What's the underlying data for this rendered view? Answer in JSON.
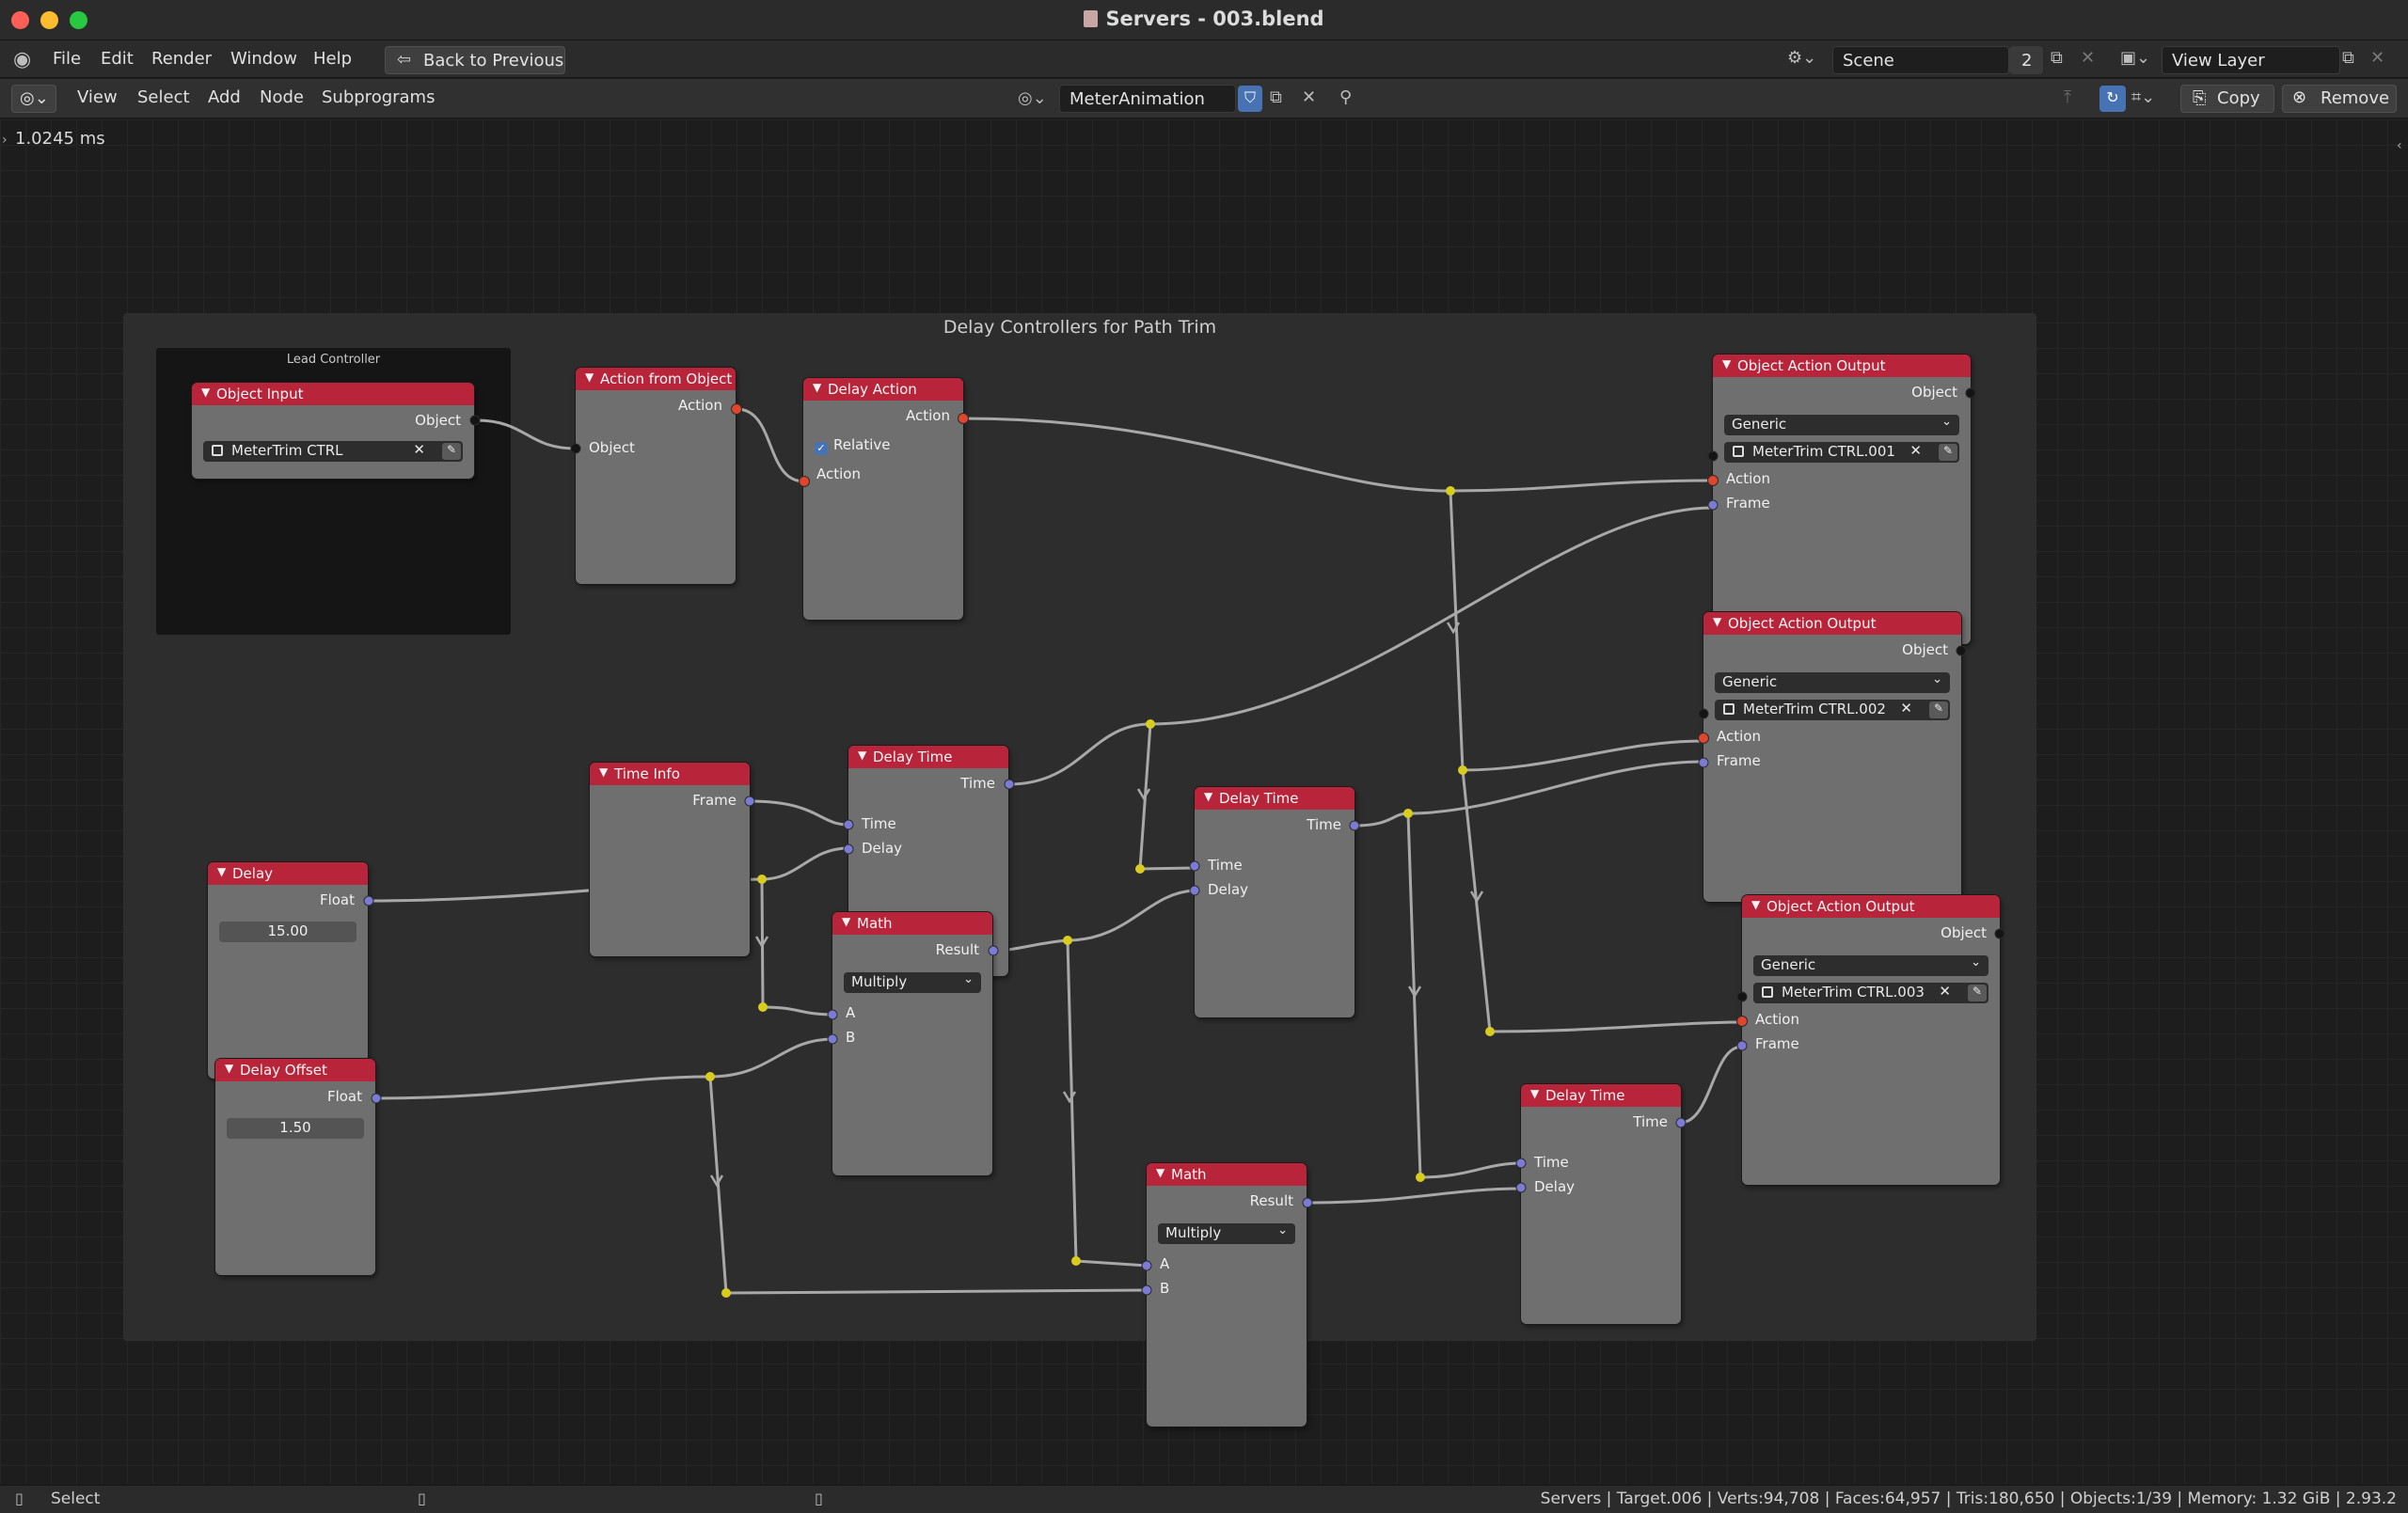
{
  "window": {
    "title": "Servers - 003.blend",
    "traffic_lights": {
      "close": "#fe5f57",
      "minimize": "#febc2e",
      "zoom": "#28c840"
    }
  },
  "menubar": {
    "items": [
      "File",
      "Edit",
      "Render",
      "Window",
      "Help"
    ],
    "back_button": "Back to Previous",
    "scene": {
      "name": "Scene",
      "users": "2"
    },
    "view_layer": "View Layer"
  },
  "editor_header": {
    "menus": [
      "View",
      "Select",
      "Add",
      "Node",
      "Subprograms"
    ],
    "node_tree": "MeterAnimation",
    "copy_label": "Copy",
    "remove_label": "Remove"
  },
  "canvas": {
    "timing": "1.0245 ms",
    "frames": {
      "main": "Delay Controllers for Path Trim",
      "lead": "Lead Controller"
    },
    "nodes": {
      "object_input": {
        "title": "Object Input",
        "out_object": "Object",
        "object_value": "MeterTrim CTRL"
      },
      "action_from_object": {
        "title": "Action from Object",
        "out_action": "Action",
        "in_object": "Object"
      },
      "delay_action": {
        "title": "Delay Action",
        "out_action": "Action",
        "relative_label": "Relative",
        "relative_checked": true,
        "in_action": "Action"
      },
      "oao_1": {
        "title": "Object Action Output",
        "out_object": "Object",
        "mode": "Generic",
        "object_value": "MeterTrim CTRL.001",
        "in_action": "Action",
        "in_frame": "Frame"
      },
      "oao_2": {
        "title": "Object Action Output",
        "out_object": "Object",
        "mode": "Generic",
        "object_value": "MeterTrim CTRL.002",
        "in_action": "Action",
        "in_frame": "Frame"
      },
      "oao_3": {
        "title": "Object Action Output",
        "out_object": "Object",
        "mode": "Generic",
        "object_value": "MeterTrim CTRL.003",
        "in_action": "Action",
        "in_frame": "Frame"
      },
      "time_info": {
        "title": "Time Info",
        "out_frame": "Frame"
      },
      "delay_time_1": {
        "title": "Delay Time",
        "out_time": "Time",
        "in_time": "Time",
        "in_delay": "Delay"
      },
      "delay_time_2": {
        "title": "Delay Time",
        "out_time": "Time",
        "in_time": "Time",
        "in_delay": "Delay"
      },
      "delay_time_3": {
        "title": "Delay Time",
        "out_time": "Time",
        "in_time": "Time",
        "in_delay": "Delay"
      },
      "delay": {
        "title": "Delay",
        "out_float": "Float",
        "value": "15.00"
      },
      "delay_offset": {
        "title": "Delay Offset",
        "out_float": "Float",
        "value": "1.50"
      },
      "math_1": {
        "title": "Math",
        "out_result": "Result",
        "operation": "Multiply",
        "in_a": "A",
        "in_b": "B"
      },
      "math_2": {
        "title": "Math",
        "out_result": "Result",
        "operation": "Multiply",
        "in_a": "A",
        "in_b": "B"
      }
    }
  },
  "statusbar": {
    "select_label": "Select",
    "info": "Servers | Target.006 | Verts:94,708 | Faces:64,957 | Tris:180,650 | Objects:1/39 | Memory: 1.32 GiB | 2.93.2"
  },
  "colors": {
    "node_header": "#b8253a",
    "socket_object": "#141414",
    "socket_action": "#e0452d",
    "socket_float": "#7b7bd6",
    "reroute": "#d8cc1f",
    "wire": "#a8a8a8",
    "accent": "#4772b3"
  }
}
